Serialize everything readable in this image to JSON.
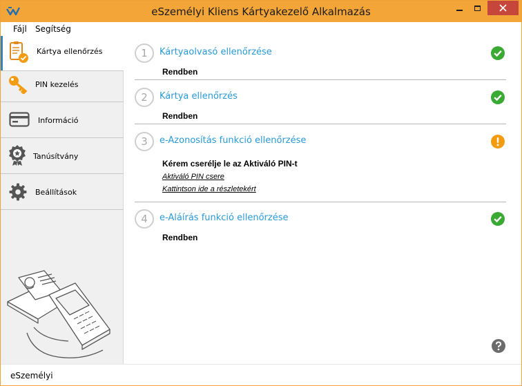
{
  "window": {
    "title": "eSzemélyi Kliens Kártyakezelő Alkalmazás"
  },
  "menu": {
    "file": "Fájl",
    "help": "Segítség"
  },
  "sidebar": {
    "items": [
      {
        "label": "Kártya ellenőrzés",
        "icon": "card-check-icon",
        "active": true
      },
      {
        "label": "PIN kezelés",
        "icon": "key-icon",
        "active": false
      },
      {
        "label": "Információ",
        "icon": "card-info-icon",
        "active": false
      },
      {
        "label": "Tanúsítvány",
        "icon": "certificate-icon",
        "active": false
      },
      {
        "label": "Beállítások",
        "icon": "gear-icon",
        "active": false
      }
    ]
  },
  "steps": [
    {
      "number": "1",
      "title": "Kártyaolvasó ellenőrzése",
      "status": "Rendben",
      "state": "ok"
    },
    {
      "number": "2",
      "title": "Kártya ellenőrzés",
      "status": "Rendben",
      "state": "ok"
    },
    {
      "number": "3",
      "title": "e-Azonosítás funkció ellenőrzése",
      "status": "Kérem cserélje le az Aktiváló PIN-t",
      "state": "warning",
      "links": [
        "Aktiváló PIN csere",
        "Kattintson ide a részletekért"
      ]
    },
    {
      "number": "4",
      "title": "e-Aláírás funkció ellenőrzése",
      "status": "Rendben",
      "state": "ok"
    }
  ],
  "statusbar": {
    "text": "eSzemélyi"
  },
  "colors": {
    "titlebar": "#f4a537",
    "accent": "#2a9ad6",
    "ok": "#3aaa35",
    "warning": "#f39c12",
    "close": "#c7463c"
  }
}
